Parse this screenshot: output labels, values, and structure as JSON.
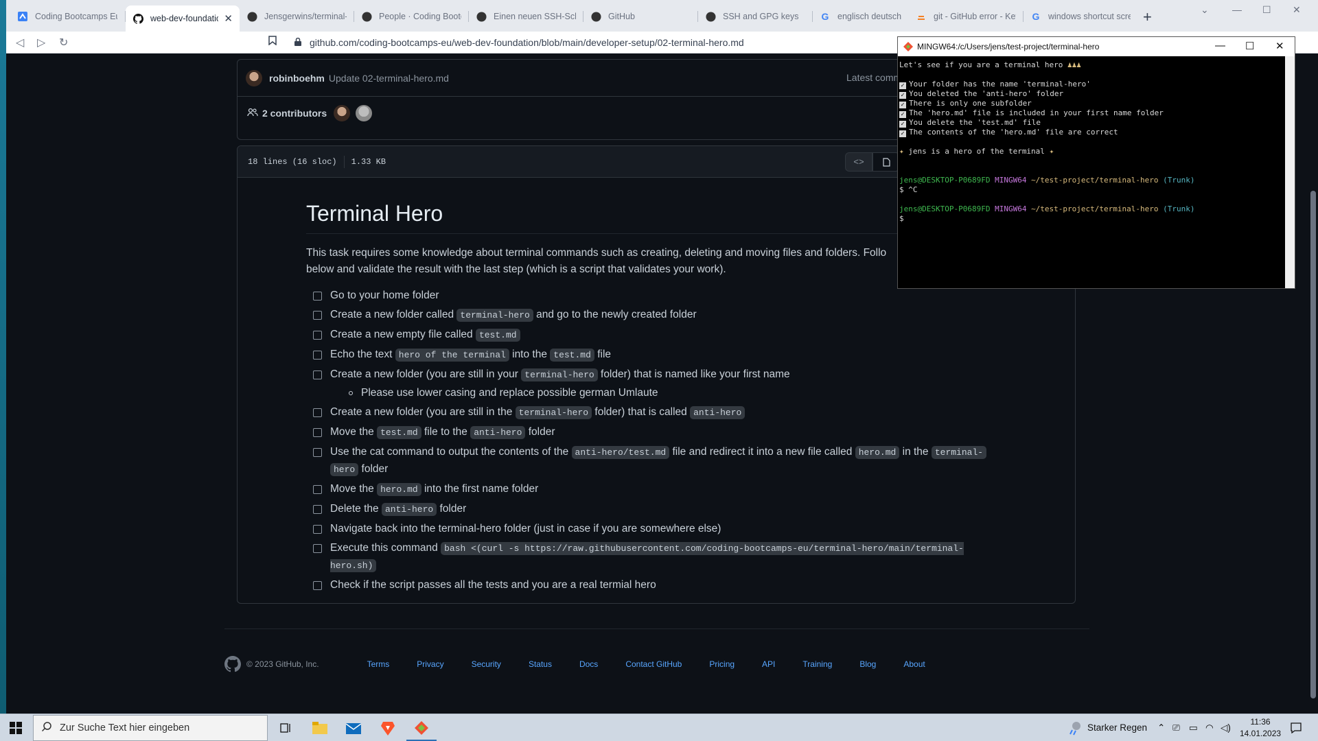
{
  "browser": {
    "tabs": [
      {
        "label": "Coding Bootcamps Euro",
        "icon": "bootcamp-icon"
      },
      {
        "label": "web-dev-foundatio",
        "icon": "github-icon",
        "active": true
      },
      {
        "label": "Jensgerwins/terminal-h",
        "icon": "github-icon"
      },
      {
        "label": "People · Coding Bootca",
        "icon": "github-icon"
      },
      {
        "label": "Einen neuen SSH-Schlü",
        "icon": "github-icon"
      },
      {
        "label": "GitHub",
        "icon": "github-icon"
      },
      {
        "label": "SSH and GPG keys",
        "icon": "github-icon"
      },
      {
        "label": "englisch deutsch übers",
        "icon": "google-icon"
      },
      {
        "label": "git - GitHub error - Key",
        "icon": "stackoverflow-icon"
      },
      {
        "label": "windows shortcut scree",
        "icon": "google-icon"
      }
    ],
    "url": "github.com/coding-bootcamps-eu/web-dev-foundation/blob/main/developer-setup/02-terminal-hero.md"
  },
  "commit": {
    "user": "robinboehm",
    "message": "Update 02-terminal-hero.md",
    "latest": "Latest comm",
    "contributors": "2 contributors"
  },
  "file": {
    "lines": "18 lines (16 sloc)",
    "size": "1.33 KB"
  },
  "readme": {
    "title": "Terminal Hero",
    "intro": "This task requires some knowledge about terminal commands such as creating, deleting and moving files and folders. Follo",
    "intro2": "below and validate the result with the last step (which is a script that validates your work).",
    "tasks": [
      {
        "pre": "Go to your home folder"
      },
      {
        "pre": "Create a new folder called ",
        "code": "terminal-hero",
        "post": " and go to the newly created folder"
      },
      {
        "pre": "Create a new empty file called ",
        "code": "test.md",
        "post": ""
      },
      {
        "pre": "Echo the text ",
        "code": "hero of the terminal",
        "post": " into the ",
        "code2": "test.md",
        "post2": " file"
      },
      {
        "pre": "Create a new folder (you are still in your ",
        "code": "terminal-hero",
        "post": " folder) that is named like your first name"
      },
      {
        "pre": "Create a new folder (you are still in the ",
        "code": "terminal-hero",
        "post": " folder) that is called ",
        "code2": "anti-hero",
        "post2": ""
      },
      {
        "pre": "Move the ",
        "code": "test.md",
        "post": " file to the ",
        "code2": "anti-hero",
        "post2": " folder"
      },
      {
        "pre": "Use the cat command to output the contents of the ",
        "code": "anti-hero/test.md",
        "post": " file and redirect it into a new file called ",
        "code2": "hero.md",
        "post2": " in the ",
        "code3": "terminal-",
        "line2code": "hero",
        "line2post": " folder"
      },
      {
        "pre": "Move the ",
        "code": "hero.md",
        "post": " into the first name folder"
      },
      {
        "pre": "Delete the ",
        "code": "anti-hero",
        "post": " folder"
      },
      {
        "pre": "Navigate back into the terminal-hero folder (just in case if you are somewhere else)"
      },
      {
        "pre": "Execute this command ",
        "code": "bash <(curl -s https://raw.githubusercontent.com/coding-bootcamps-eu/terminal-hero/main/terminal-hero.sh)",
        "post": ""
      },
      {
        "pre": "Check if the script passes all the tests and you are a real termial hero"
      }
    ],
    "subitem": "Please use lower casing and replace possible german Umlaute"
  },
  "footer": {
    "copyright": "© 2023 GitHub, Inc.",
    "links": [
      "Terms",
      "Privacy",
      "Security",
      "Status",
      "Docs",
      "Contact GitHub",
      "Pricing",
      "API",
      "Training",
      "Blog",
      "About"
    ]
  },
  "terminal": {
    "title": "MINGW64:/c/Users/jens/test-project/terminal-hero",
    "intro": "Let's see if you are a terminal hero",
    "checks": [
      "Your folder has the name 'terminal-hero'",
      "You deleted the 'anti-hero' folder",
      "There is only one subfolder",
      "The 'hero.md' file is included in your first name folder",
      "You delete the 'test.md' file",
      "The contents of the 'hero.md' file are correct"
    ],
    "hero_line": "jens is a hero of the terminal",
    "prompt_user": "jens@DESKTOP-P0689FD",
    "prompt_sys": "MINGW64",
    "prompt_path": "~/test-project/terminal-hero",
    "prompt_branch": "(Trunk)",
    "cmd1": "$ ^C",
    "cmd2": "$"
  },
  "taskbar": {
    "search_placeholder": "Zur Suche Text hier eingeben",
    "weather": "Starker Regen",
    "time": "11:36",
    "date": "14.01.2023"
  }
}
